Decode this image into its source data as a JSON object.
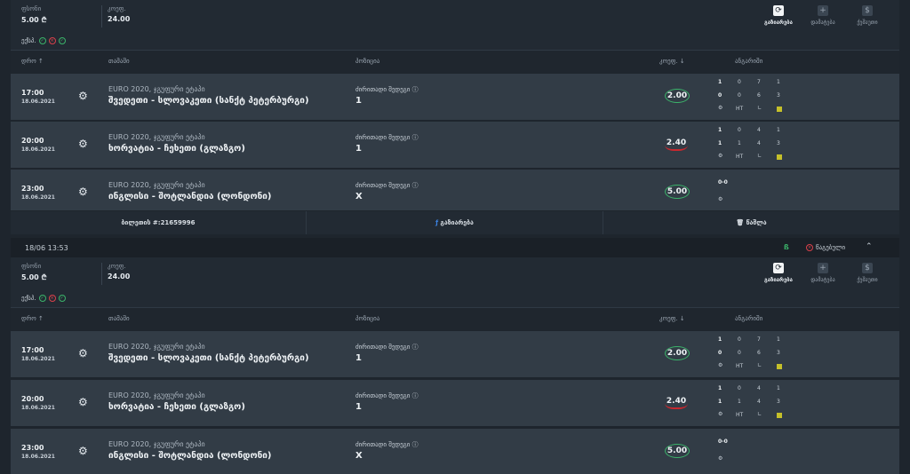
{
  "bet": {
    "stake_label": "ფსონი",
    "stake_value": "5.00 ₾",
    "odds_label": "კოეფ.",
    "odds_value": "24.00",
    "tools": [
      "გაზიარება",
      "დამატება",
      "ქეშაუთი"
    ],
    "type_label": "ექსპ.",
    "columns": [
      "დრო ↑",
      "თამაში",
      "პოზიცია",
      "კოეფ. ↓",
      "ანგარიში"
    ]
  },
  "rows": [
    {
      "time": "17:00",
      "date": "18.06.2021",
      "tournament": "EURO 2020, ჯგუფური ეტაპი",
      "match": "შვედეთი - სლოვაკეთი (სანქტ პეტერბურგი)",
      "market": "ძირითადი შედეგი ⓘ",
      "pick": "1",
      "odd": "2.00",
      "score": {
        "r1": [
          "1",
          "0",
          "7",
          "1"
        ],
        "r2": [
          "0",
          "0",
          "6",
          "3"
        ],
        "ht": "HT"
      }
    },
    {
      "time": "20:00",
      "date": "18.06.2021",
      "tournament": "EURO 2020, ჯგუფური ეტაპი",
      "match": "ხორვატია - ჩეხეთი (გლაზგო)",
      "market": "ძირითადი შედეგი ⓘ",
      "pick": "1",
      "odd": "2.40",
      "score": {
        "r1": [
          "1",
          "0",
          "4",
          "1"
        ],
        "r2": [
          "1",
          "1",
          "4",
          "3"
        ],
        "ht": "HT"
      }
    },
    {
      "time": "23:00",
      "date": "18.06.2021",
      "tournament": "EURO 2020, ჯგუფური ეტაპი",
      "match": "ინგლისი - შოტლანდია (ლონდონი)",
      "market": "ძირითადი შედეგი ⓘ",
      "pick": "X",
      "odd": "5.00",
      "score": {
        "final": "0-0"
      }
    }
  ],
  "footer": {
    "ticket": "ბილეთის #:21659996",
    "share": "გაზიარება",
    "delete": "წაშლა"
  },
  "divider": {
    "datetime": "18/06 13:53",
    "lost": "წაგებული"
  }
}
